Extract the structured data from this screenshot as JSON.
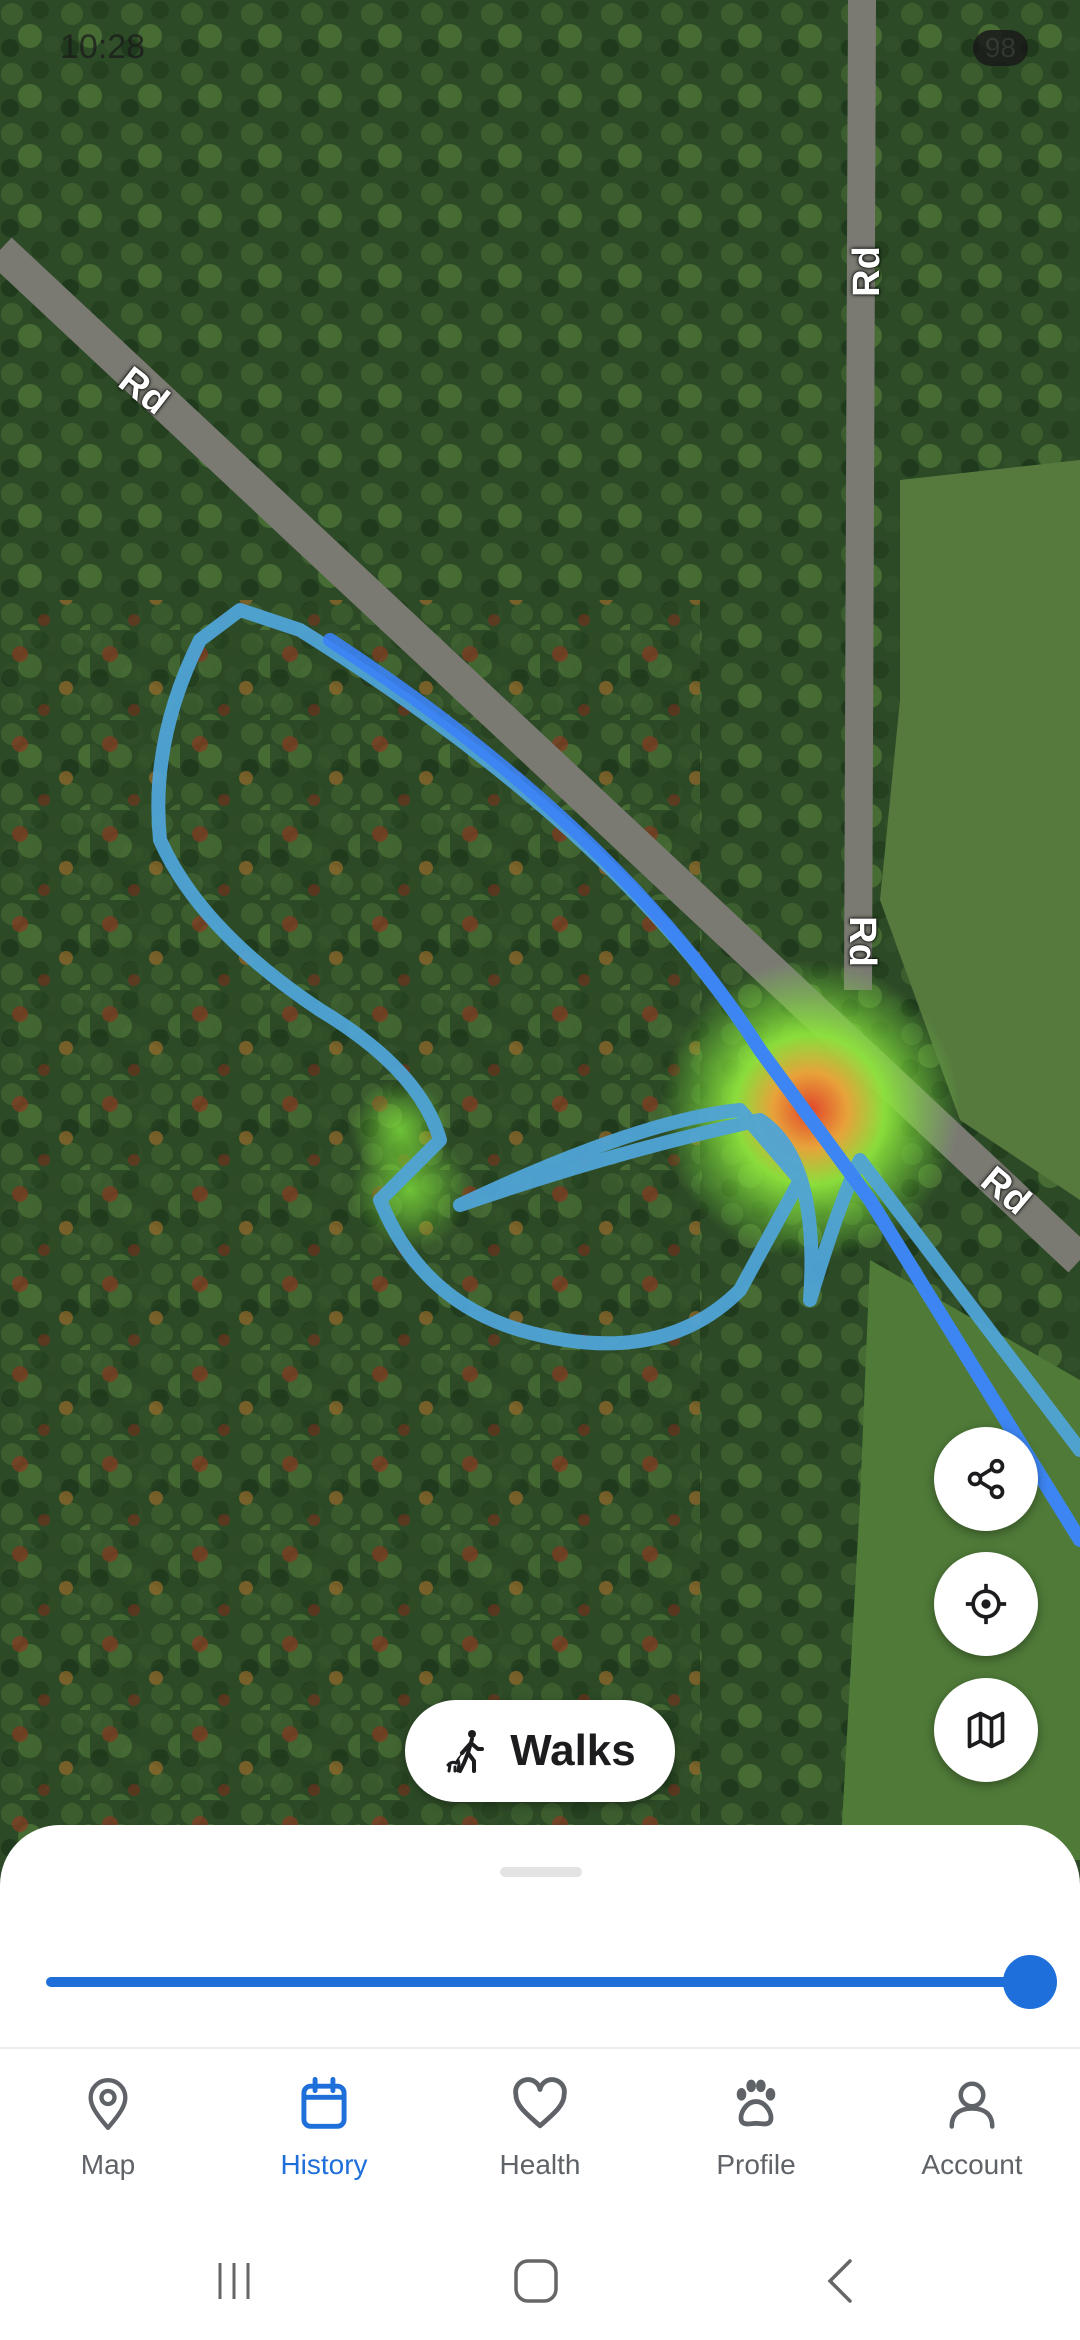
{
  "status_bar": {
    "time": "10:28",
    "battery": "98"
  },
  "map": {
    "road_labels": {
      "road_nw": "Rd",
      "road_n": "Rd",
      "road_mid": "Rd",
      "road_se": "Rd"
    },
    "track_color": "#3b82f6",
    "heat_colors": [
      "#7ee03a",
      "#e0452a"
    ]
  },
  "fabs": {
    "share_icon": "share-icon",
    "locate_icon": "crosshair-icon",
    "layers_icon": "map-icon"
  },
  "walks_button": {
    "label": "Walks",
    "icon": "dog-walker-icon"
  },
  "timeline_slider": {
    "value": 1.0
  },
  "tabs": [
    {
      "label": "Map",
      "icon": "map-pin-icon"
    },
    {
      "label": "History",
      "icon": "calendar-icon"
    },
    {
      "label": "Health",
      "icon": "heart-icon"
    },
    {
      "label": "Profile",
      "icon": "paw-icon"
    },
    {
      "label": "Account",
      "icon": "person-icon"
    }
  ],
  "active_tab": "History"
}
